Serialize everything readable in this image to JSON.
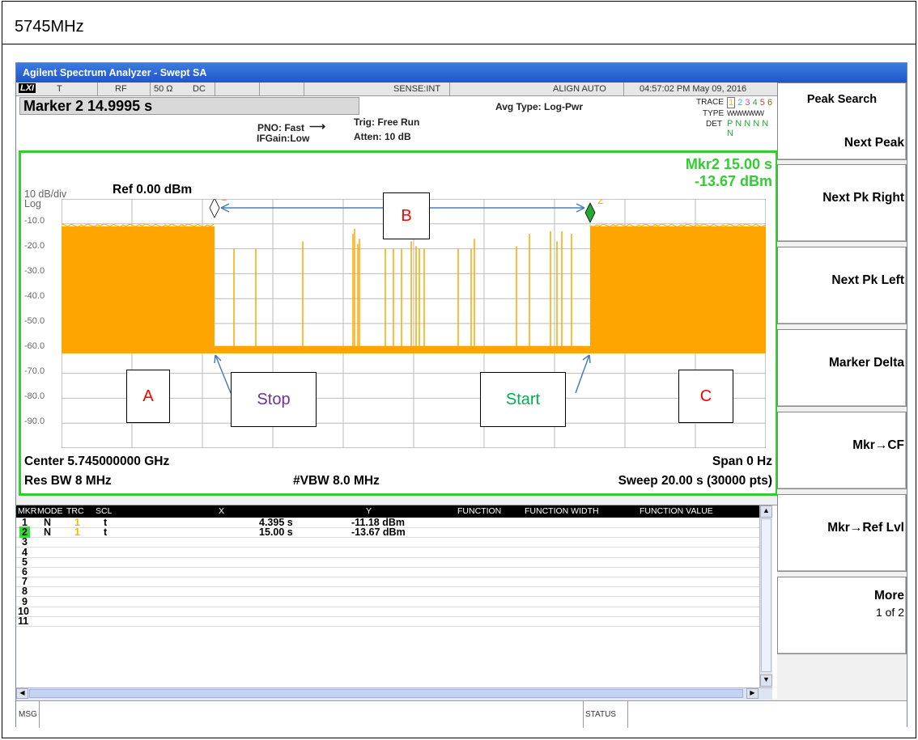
{
  "header": {
    "frequency": "5745MHz"
  },
  "window": {
    "title": "Agilent Spectrum Analyzer - Swept SA"
  },
  "status_bar": {
    "lxi": "LXI",
    "t": "T",
    "rf": "RF",
    "impedance": "50 Ω",
    "coupling": "DC",
    "sense": "SENSE:INT",
    "align": "ALIGN AUTO",
    "datetime": "04:57:02 PM May 09, 2016"
  },
  "info": {
    "marker": "Marker 2 14.9995 s",
    "pno": "PNO: Fast",
    "ifgain": "IFGain:Low",
    "trig": "Trig: Free Run",
    "atten": "Atten: 10 dB",
    "avg_type": "Avg Type: Log-Pwr",
    "trace_label": "TRACE",
    "trace_vals": [
      "1",
      "2",
      "3",
      "4",
      "5",
      "6"
    ],
    "type_label": "TYPE",
    "type_vals": "WWWWWW",
    "det_label": "DET",
    "det_vals": "P N N N N N"
  },
  "screen": {
    "scale": "10 dB/div",
    "log": "Log",
    "ref": "Ref 0.00 dBm",
    "mkr_line1": "Mkr2 15.00 s",
    "mkr_line2": "-13.67 dBm",
    "y_ticks": [
      "-10.0",
      "-20.0",
      "-30.0",
      "-40.0",
      "-50.0",
      "-60.0",
      "-70.0",
      "-80.0",
      "-90.0"
    ],
    "center": "Center 5.745000000 GHz",
    "span": "Span 0 Hz",
    "rbw": "Res BW 8 MHz",
    "vbw": "#VBW 8.0 MHz",
    "sweep": "Sweep  20.00 s (30000 pts)",
    "marker1_num": "1",
    "marker2_num": "2"
  },
  "annotations": {
    "a": "A",
    "b": "B",
    "c": "C",
    "stop": "Stop",
    "start": "Start"
  },
  "table": {
    "headers": [
      "MKR",
      "MODE",
      "TRC",
      "SCL",
      "X",
      "Y",
      "FUNCTION",
      "FUNCTION WIDTH",
      "FUNCTION VALUE"
    ],
    "rows": [
      {
        "n": "1",
        "mode": "N",
        "trc": "1",
        "scl": "t",
        "x": "4.395 s",
        "y": "-11.18 dBm"
      },
      {
        "n": "2",
        "mode": "N",
        "trc": "1",
        "scl": "t",
        "x": "15.00 s",
        "y": "-13.67 dBm"
      },
      {
        "n": "3"
      },
      {
        "n": "4"
      },
      {
        "n": "5"
      },
      {
        "n": "6"
      },
      {
        "n": "7"
      },
      {
        "n": "8"
      },
      {
        "n": "9"
      },
      {
        "n": "10"
      },
      {
        "n": "11"
      }
    ]
  },
  "msg_bar": {
    "msg": "MSG",
    "status": "STATUS"
  },
  "softkeys": {
    "title": "Peak Search",
    "next_peak": "Next Peak",
    "next_pk_right": "Next Pk Right",
    "next_pk_left": "Next Pk Left",
    "marker_delta": "Marker Delta",
    "mkr_cf": "Mkr→CF",
    "mkr_ref": "Mkr→Ref Lvl",
    "more": "More",
    "more_page": "1 of 2"
  },
  "colors": {
    "trace": "#ffa500",
    "frame_green": "#33cc33",
    "marker_green": "#22aa33",
    "annot_red": "#ff0000",
    "stop_purple": "#7030a0",
    "start_green": "#00b050",
    "arrow_blue": "#4a7ebb"
  }
}
